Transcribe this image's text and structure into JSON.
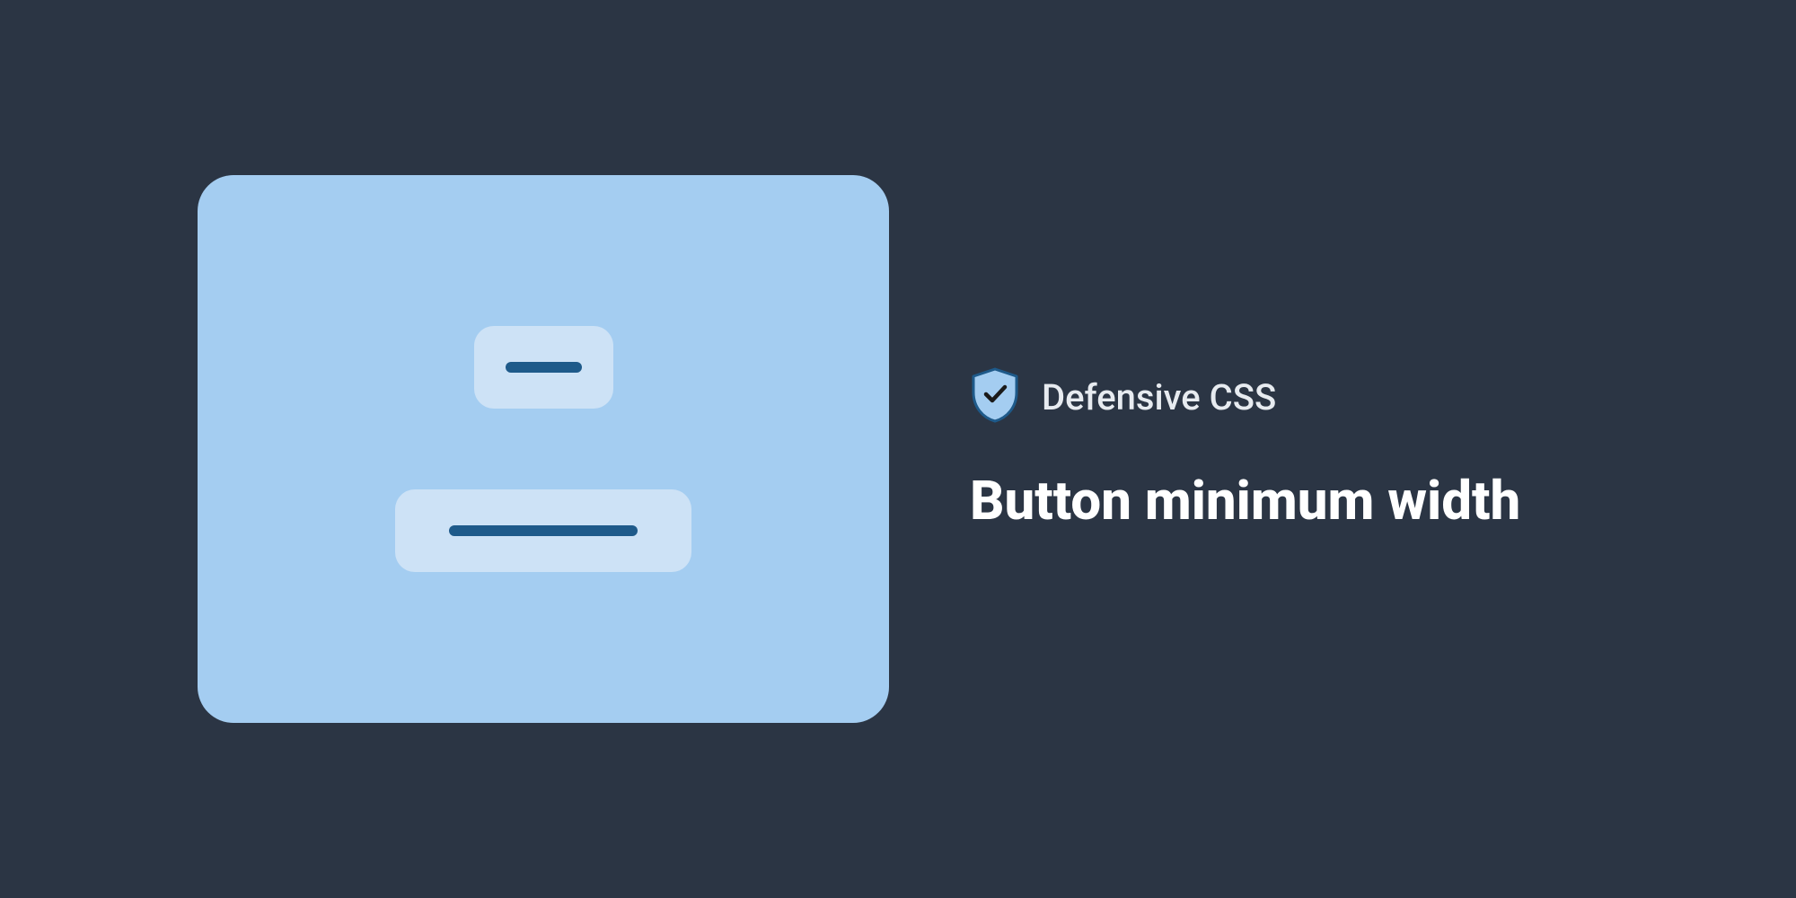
{
  "brand": {
    "label": "Defensive CSS"
  },
  "title": "Button minimum width",
  "colors": {
    "background": "#2b3544",
    "card": "#a4cdf1",
    "button": "#cde2f6",
    "bar": "#1e5a8a",
    "text": "#ffffff",
    "brand_text": "#e7ebf0"
  }
}
